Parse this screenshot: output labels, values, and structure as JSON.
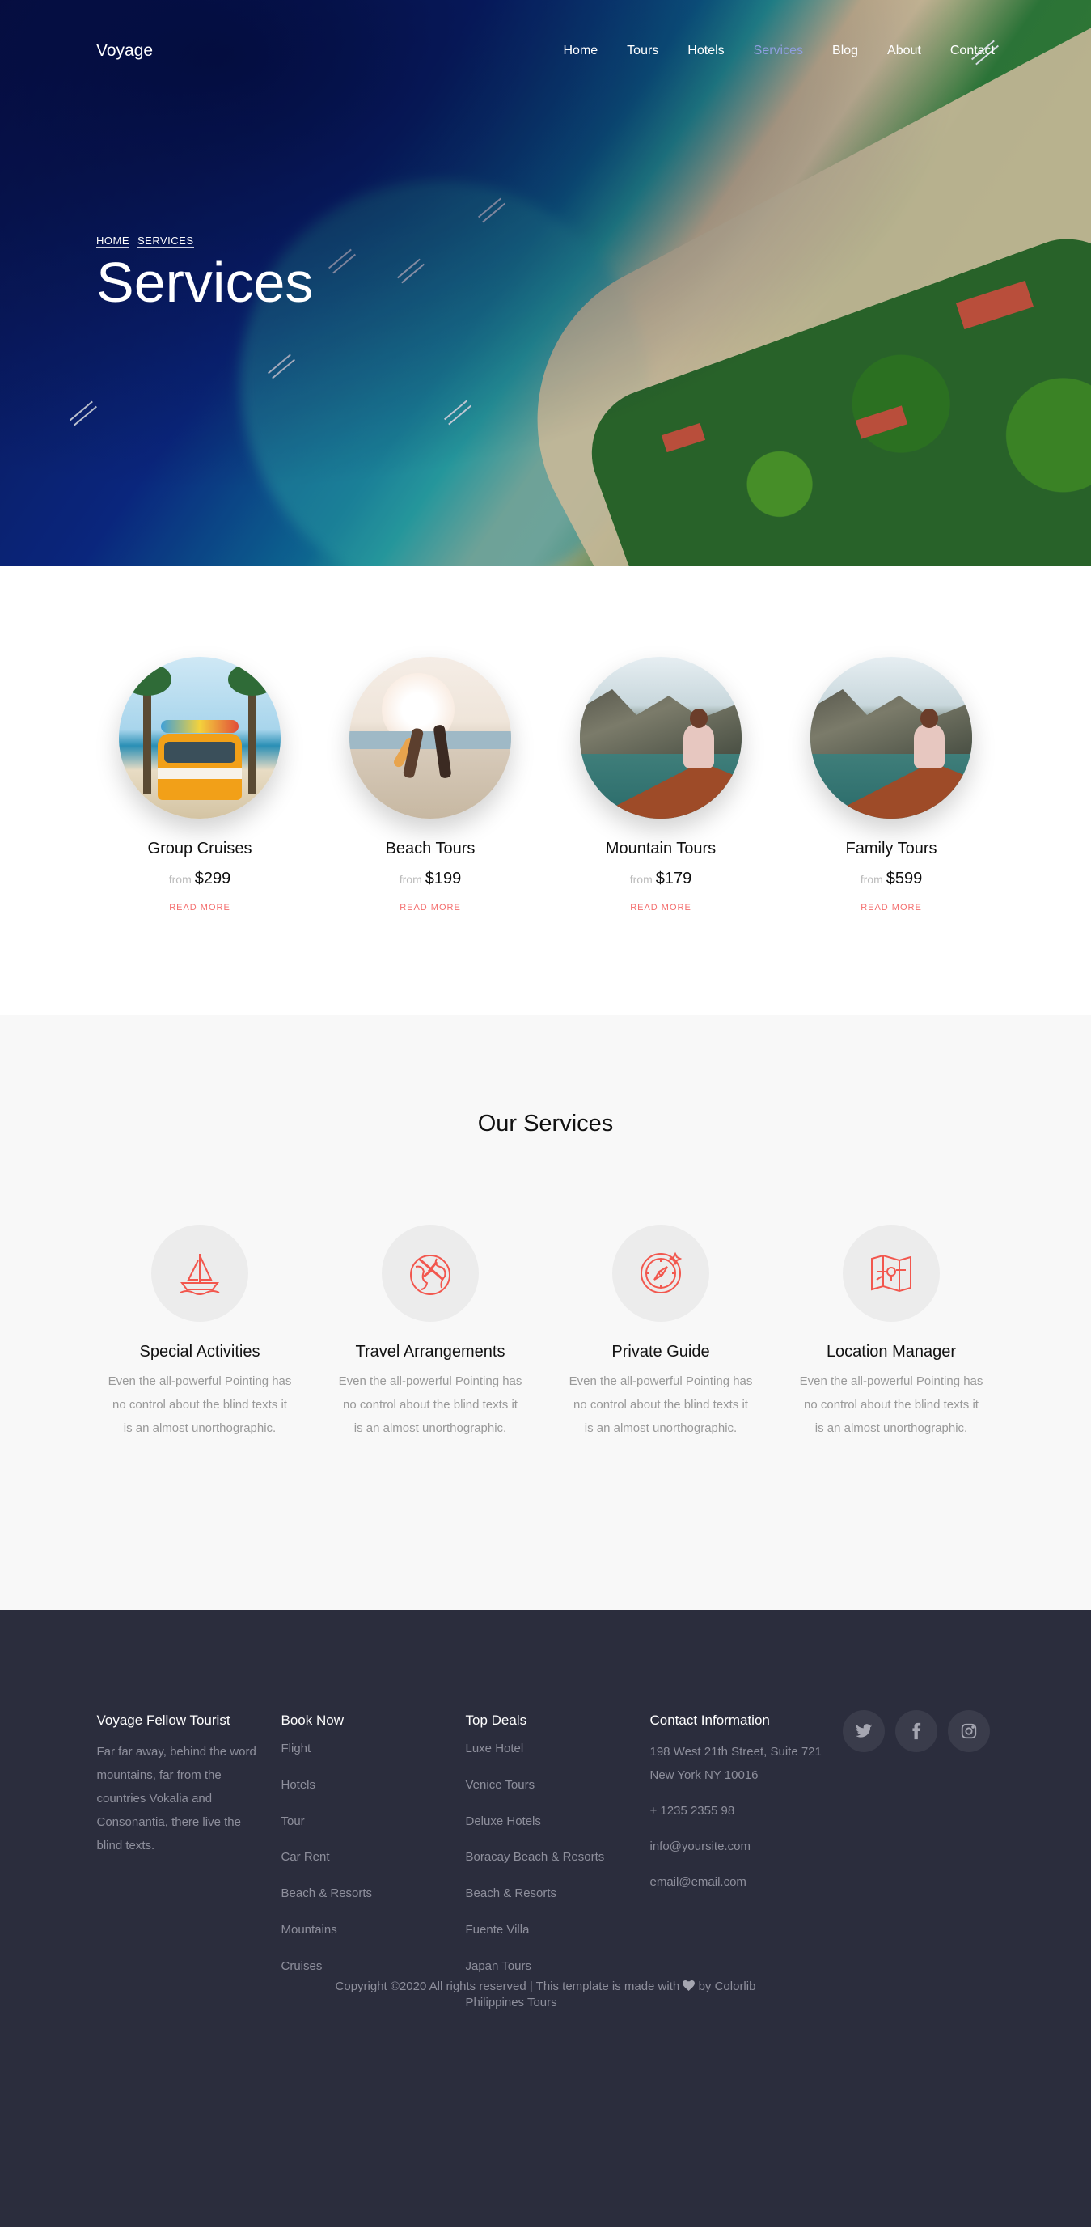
{
  "nav": {
    "brand": "Voyage",
    "items": [
      {
        "label": "Home"
      },
      {
        "label": "Tours"
      },
      {
        "label": "Hotels"
      },
      {
        "label": "Services"
      },
      {
        "label": "Blog"
      },
      {
        "label": "About"
      },
      {
        "label": "Contact"
      }
    ],
    "active_item": "Services",
    "active_color": "#8f9ee0"
  },
  "hero": {
    "breadcrumbs": [
      "HOME",
      "SERVICES"
    ],
    "title": "Services"
  },
  "tours": [
    {
      "name": "Group Cruises",
      "from_label": "from",
      "price": "$299",
      "link": "READ MORE",
      "image": "camper-van-beach"
    },
    {
      "name": "Beach Tours",
      "from_label": "from",
      "price": "$199",
      "link": "READ MORE",
      "image": "couple-beach-surfboards"
    },
    {
      "name": "Mountain Tours",
      "from_label": "from",
      "price": "$179",
      "link": "READ MORE",
      "image": "woman-boat-lagoon"
    },
    {
      "name": "Family Tours",
      "from_label": "from",
      "price": "$599",
      "link": "READ MORE",
      "image": "woman-boat-lagoon"
    }
  ],
  "services": {
    "heading": "Our Services",
    "items": [
      {
        "title": "Special Activities",
        "icon": "sailboat-icon",
        "text": "Even the all-powerful Pointing has no control about the blind texts it is an almost unorthographic."
      },
      {
        "title": "Travel Arrangements",
        "icon": "globe-plane-icon",
        "text": "Even the all-powerful Pointing has no control about the blind texts it is an almost unorthographic."
      },
      {
        "title": "Private Guide",
        "icon": "compass-icon",
        "text": "Even the all-powerful Pointing has no control about the blind texts it is an almost unorthographic."
      },
      {
        "title": "Location Manager",
        "icon": "map-pin-icon",
        "text": "Even the all-powerful Pointing has no control about the blind texts it is an almost unorthographic."
      }
    ],
    "accent_color": "#f2574e"
  },
  "footer": {
    "about": {
      "heading": "Voyage Fellow Tourist",
      "text": "Far far away, behind the word mountains, far from the countries Vokalia and Consonantia, there live the blind texts."
    },
    "book_now": {
      "heading": "Book Now",
      "items": [
        "Flight",
        "Hotels",
        "Tour",
        "Car Rent",
        "Beach & Resorts",
        "Mountains",
        "Cruises"
      ]
    },
    "top_deals": {
      "heading": "Top Deals",
      "items": [
        "Luxe Hotel",
        "Venice Tours",
        "Deluxe Hotels",
        "Boracay Beach & Resorts",
        "Beach & Resorts",
        "Fuente Villa",
        "Japan Tours",
        "Philippines Tours"
      ]
    },
    "contact": {
      "heading": "Contact Information",
      "address": "198 West 21th Street, Suite 721 New York NY 10016",
      "phone": "+ 1235 2355 98",
      "email1": "info@yoursite.com",
      "email2": "email@email.com"
    },
    "social": [
      "twitter-icon",
      "facebook-icon",
      "instagram-icon"
    ],
    "copyright_pre": "Copyright ©2020 All rights reserved | This template is made with",
    "copyright_post": "by Colorlib"
  },
  "colors": {
    "footer_bg": "#2b2d3d",
    "read_more": "#f46d6d",
    "services_bg": "#f8f8f8"
  }
}
